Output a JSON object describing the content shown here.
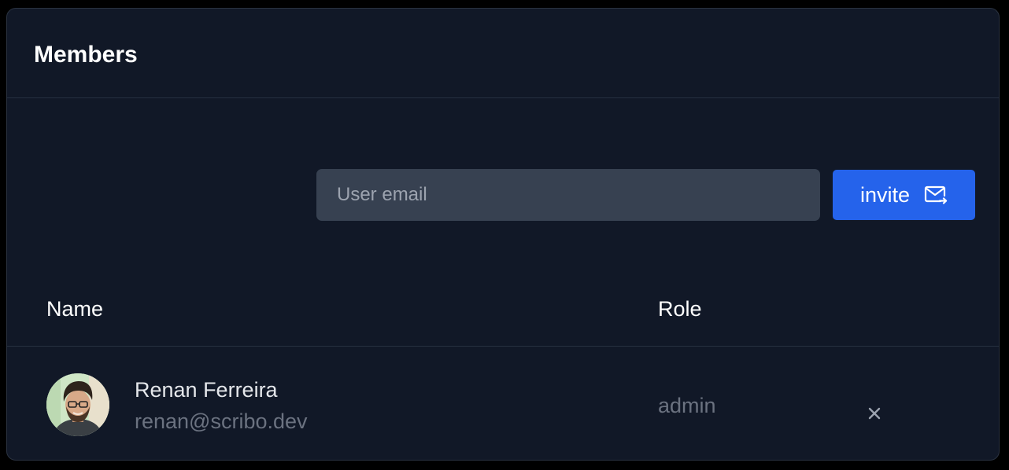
{
  "card": {
    "title": "Members"
  },
  "invite": {
    "email_placeholder": "User email",
    "email_value": "",
    "button_label": "invite",
    "button_icon": "mail-send-icon"
  },
  "table": {
    "columns": [
      "Name",
      "Role"
    ],
    "rows": [
      {
        "avatar": "avatar-photo",
        "name": "Renan Ferreira",
        "email": "renan@scribo.dev",
        "role": "admin",
        "action_icon": "close-icon"
      }
    ]
  },
  "colors": {
    "page_background": "#000000",
    "card_background": "#111827",
    "input_background": "#374151",
    "accent": "#2563eb",
    "muted_text": "#6b7280"
  }
}
